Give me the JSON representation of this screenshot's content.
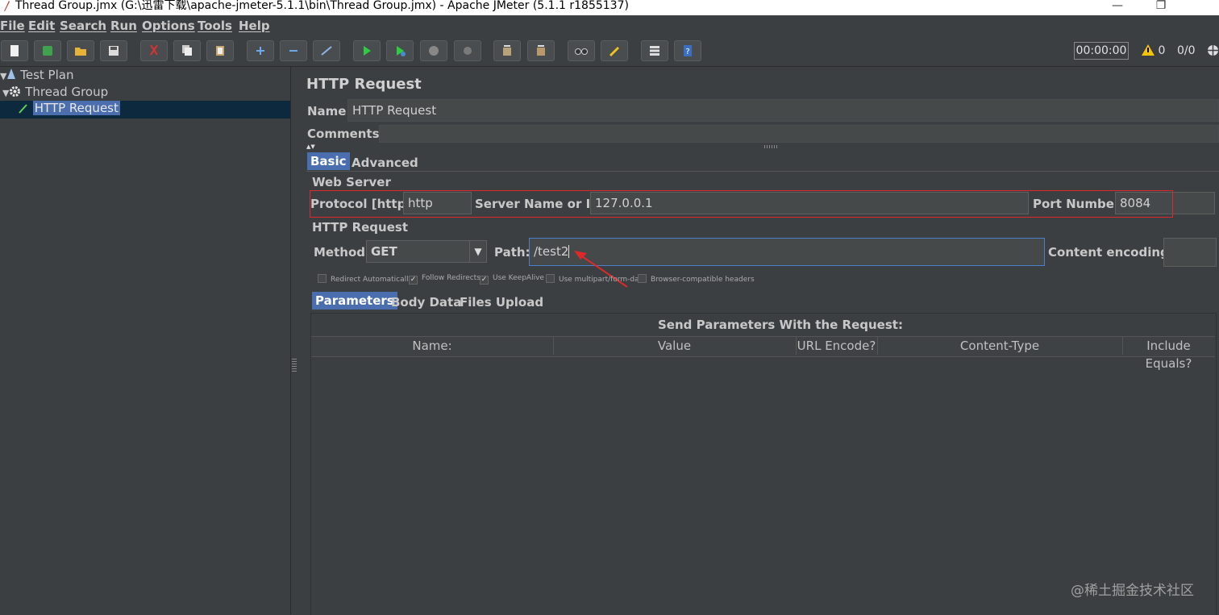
{
  "window": {
    "title": "Thread Group.jmx (G:\\迅雷下载\\apache-jmeter-5.1.1\\bin\\Thread Group.jmx) - Apache JMeter (5.1.1 r1855137)",
    "minimize": "—",
    "restore": "❐"
  },
  "menu": [
    "File",
    "Edit",
    "Search",
    "Run",
    "Options",
    "Tools",
    "Help"
  ],
  "toolbar": {
    "icons": [
      "new-icon",
      "templates-icon",
      "open-icon",
      "save-icon",
      "cut-icon",
      "copy-icon",
      "paste-icon",
      "expand-icon",
      "collapse-icon",
      "toggle-icon",
      "start-icon",
      "start-no-timers-icon",
      "stop-icon",
      "shutdown-icon",
      "clear-icon",
      "clear-all-icon",
      "search-icon",
      "reset-search-icon",
      "function-helper-icon",
      "help-icon"
    ],
    "timer": "00:00:00",
    "warnings": "0",
    "threads": "0/0"
  },
  "tree": [
    {
      "label": "Test Plan",
      "icon": "test-plan-icon"
    },
    {
      "label": "Thread Group",
      "icon": "gear-icon"
    },
    {
      "label": "HTTP Request",
      "icon": "pipette-icon",
      "selected": true
    }
  ],
  "panel": {
    "title": "HTTP Request",
    "name_label": "Name:",
    "name_value": "HTTP Request",
    "comments_label": "Comments:",
    "tabs": [
      "Basic",
      "Advanced"
    ],
    "web_server": {
      "heading": "Web Server",
      "protocol_label": "Protocol [http]:",
      "protocol_value": "http",
      "server_label": "Server Name or IP:",
      "server_value": "127.0.0.1",
      "port_label": "Port Number:",
      "port_value": "8084"
    },
    "http_request": {
      "heading": "HTTP Request",
      "method_label": "Method:",
      "method_value": "GET",
      "path_label": "Path:",
      "path_value": "/test2",
      "encoding_label": "Content encoding:",
      "encoding_value": ""
    },
    "checkboxes": [
      {
        "label": "Redirect Automatically",
        "checked": false
      },
      {
        "label": "Follow Redirects",
        "checked": true
      },
      {
        "label": "Use KeepAlive",
        "checked": true
      },
      {
        "label": "Use multipart/form-data",
        "checked": false
      },
      {
        "label": "Browser-compatible headers",
        "checked": false
      }
    ],
    "sub_tabs": [
      "Parameters",
      "Body Data",
      "Files Upload"
    ],
    "params_title": "Send Parameters With the Request:",
    "columns": [
      "Name:",
      "Value",
      "URL Encode?",
      "Content-Type",
      "Include Equals?"
    ]
  },
  "watermark": "@稀土掘金技术社区",
  "colors": {
    "accent": "#4b6eaf",
    "highlight_box": "#e0282a",
    "background": "#3c3f41"
  }
}
